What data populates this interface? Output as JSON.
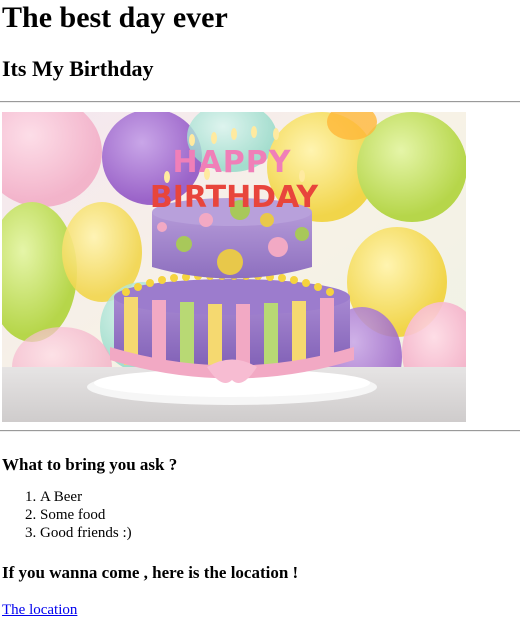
{
  "header": {
    "title": "The best day ever",
    "subtitle": "Its My Birthday"
  },
  "image": {
    "cake_text_line1": "HAPPY",
    "cake_text_line2": "BIRTHDAY"
  },
  "bring": {
    "heading": "What to bring you ask ?",
    "items": [
      "A Beer",
      "Some food",
      "Good friends :)"
    ]
  },
  "location": {
    "heading": "If you wanna come , here is the location !",
    "link_text": "The location"
  }
}
